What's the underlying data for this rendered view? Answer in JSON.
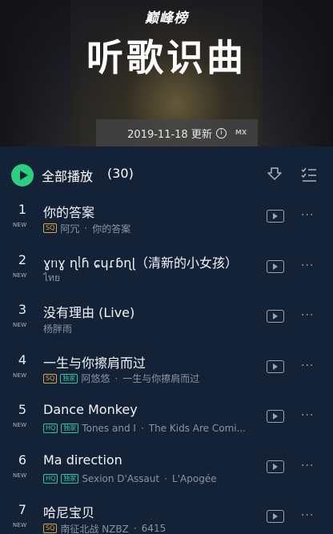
{
  "header": {
    "brand": "巅峰榜",
    "title": "听歌识曲",
    "update_date": "2019-11-18 更新",
    "info_glyph": "i",
    "logo_text": "MX"
  },
  "playbar": {
    "play_all_label": "全部播放",
    "count": "(30)"
  },
  "songs": [
    {
      "rank": "1",
      "new": "NEW",
      "title": "你的答案",
      "badges": [
        "SQ"
      ],
      "artist": "阿冗",
      "sep": "·",
      "album": "你的答案"
    },
    {
      "rank": "2",
      "new": "NEW",
      "title": "ɣᥒɣ ɳᥣɦ ɕɥɾɓɳɭ（清新的小女孩）",
      "badges": [],
      "artist": "ไทย",
      "sep": "",
      "album": ""
    },
    {
      "rank": "3",
      "new": "NEW",
      "title": "没有理由 (Live)",
      "badges": [],
      "artist": "杨胖雨",
      "sep": "",
      "album": ""
    },
    {
      "rank": "4",
      "new": "NEW",
      "title": "一生与你擦肩而过",
      "badges": [
        "SQ",
        "独家"
      ],
      "artist": "阿悠悠",
      "sep": "·",
      "album": "一生与你擦肩而过"
    },
    {
      "rank": "5",
      "new": "NEW",
      "title": "Dance Monkey",
      "badges": [
        "HQ",
        "独家"
      ],
      "artist": "Tones and I",
      "sep": "·",
      "album": "The Kids Are Comi..."
    },
    {
      "rank": "6",
      "new": "NEW",
      "title": "Ma direction",
      "badges": [
        "HQ",
        "独家"
      ],
      "artist": "Sexion D'Assaut",
      "sep": "·",
      "album": "L'Apogée"
    },
    {
      "rank": "7",
      "new": "NEW",
      "title": "哈尼宝贝",
      "badges": [
        "SQ"
      ],
      "artist": "南征北战 NZBZ",
      "sep": "·",
      "album": "6415"
    }
  ],
  "icons": {
    "play_all": "play-circle-icon",
    "download": "download-icon",
    "multiselect": "multiselect-icon",
    "mv": "mv-play-icon",
    "more": "more-icon"
  },
  "colors": {
    "background": "#142238",
    "accent_green": "#2bd07e",
    "sq_badge": "#d9a441",
    "hq_badge": "#33c5a8",
    "muted_text": "#8993a4"
  }
}
